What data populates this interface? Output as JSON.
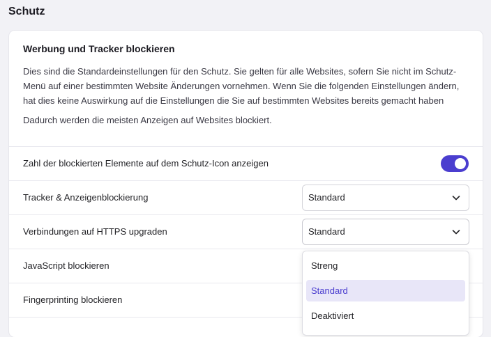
{
  "page": {
    "heading": "Schutz"
  },
  "card": {
    "title": "Werbung und Tracker blockieren",
    "description": "Dies sind die Standardeinstellungen für den Schutz. Sie gelten für alle Websites, sofern Sie nicht im Schutz-Menü auf einer bestimmten Website Änderungen vornehmen. Wenn Sie die folgenden Einstellungen ändern, hat dies keine Auswirkung auf die Einstellungen die Sie auf bestimmten Websites bereits gemacht haben",
    "note": "Dadurch werden die meisten Anzeigen auf Websites blockiert."
  },
  "rows": {
    "show_count": {
      "label": "Zahl der blockierten Elemente auf dem Schutz-Icon anzeigen",
      "enabled": true
    },
    "tracker_ads": {
      "label": "Tracker & Anzeigenblockierung",
      "value": "Standard"
    },
    "https_upgrade": {
      "label": "Verbindungen auf HTTPS upgraden",
      "value": "Standard"
    },
    "javascript": {
      "label": "JavaScript blockieren"
    },
    "fingerprinting": {
      "label": "Fingerprinting blockieren"
    }
  },
  "dropdown": {
    "options": [
      "Streng",
      "Standard",
      "Deaktiviert"
    ],
    "selected": "Standard"
  },
  "colors": {
    "accent": "#4b3ecf",
    "selected_bg": "#e8e6f8"
  },
  "icons": {
    "select_arrow": "chevron-down-icon"
  }
}
